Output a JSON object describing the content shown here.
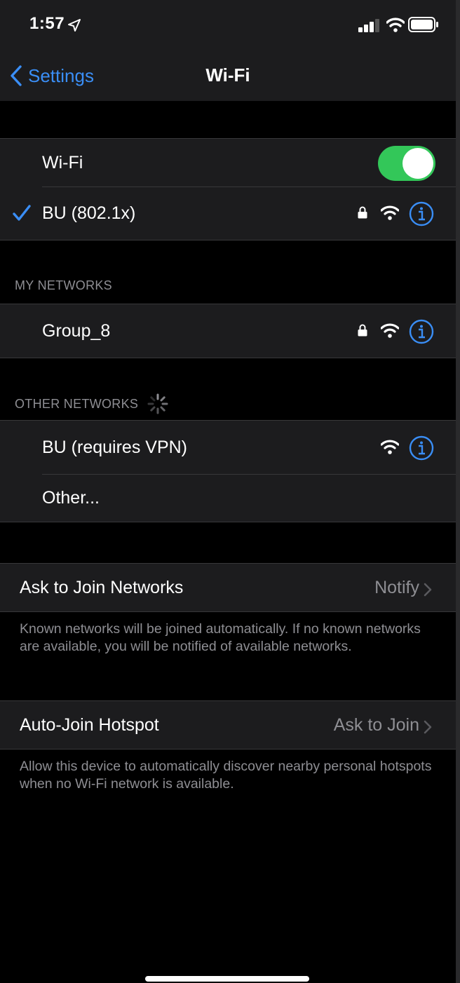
{
  "status": {
    "time": "1:57"
  },
  "nav": {
    "back_label": "Settings",
    "title": "Wi-Fi"
  },
  "wifi": {
    "toggle_label": "Wi-Fi",
    "toggle_on": true,
    "connected_network": "BU (802.1x)"
  },
  "my_networks": {
    "header": "MY NETWORKS",
    "items": [
      {
        "name": "Group_8",
        "locked": true
      }
    ]
  },
  "other_networks": {
    "header": "OTHER NETWORKS",
    "items": [
      {
        "name": "BU (requires VPN)",
        "locked": false
      },
      {
        "name": "Other..."
      }
    ]
  },
  "ask_to_join": {
    "label": "Ask to Join Networks",
    "value": "Notify",
    "footnote": "Known networks will be joined automatically. If no known networks are available, you will be notified of available networks."
  },
  "auto_join_hotspot": {
    "label": "Auto-Join Hotspot",
    "value": "Ask to Join",
    "footnote": "Allow this device to automatically discover nearby personal hotspots when no Wi-Fi network is available."
  },
  "colors": {
    "accent": "#3a8ef6",
    "toggle_on": "#33c759",
    "secondary_text": "#8e8e93"
  }
}
